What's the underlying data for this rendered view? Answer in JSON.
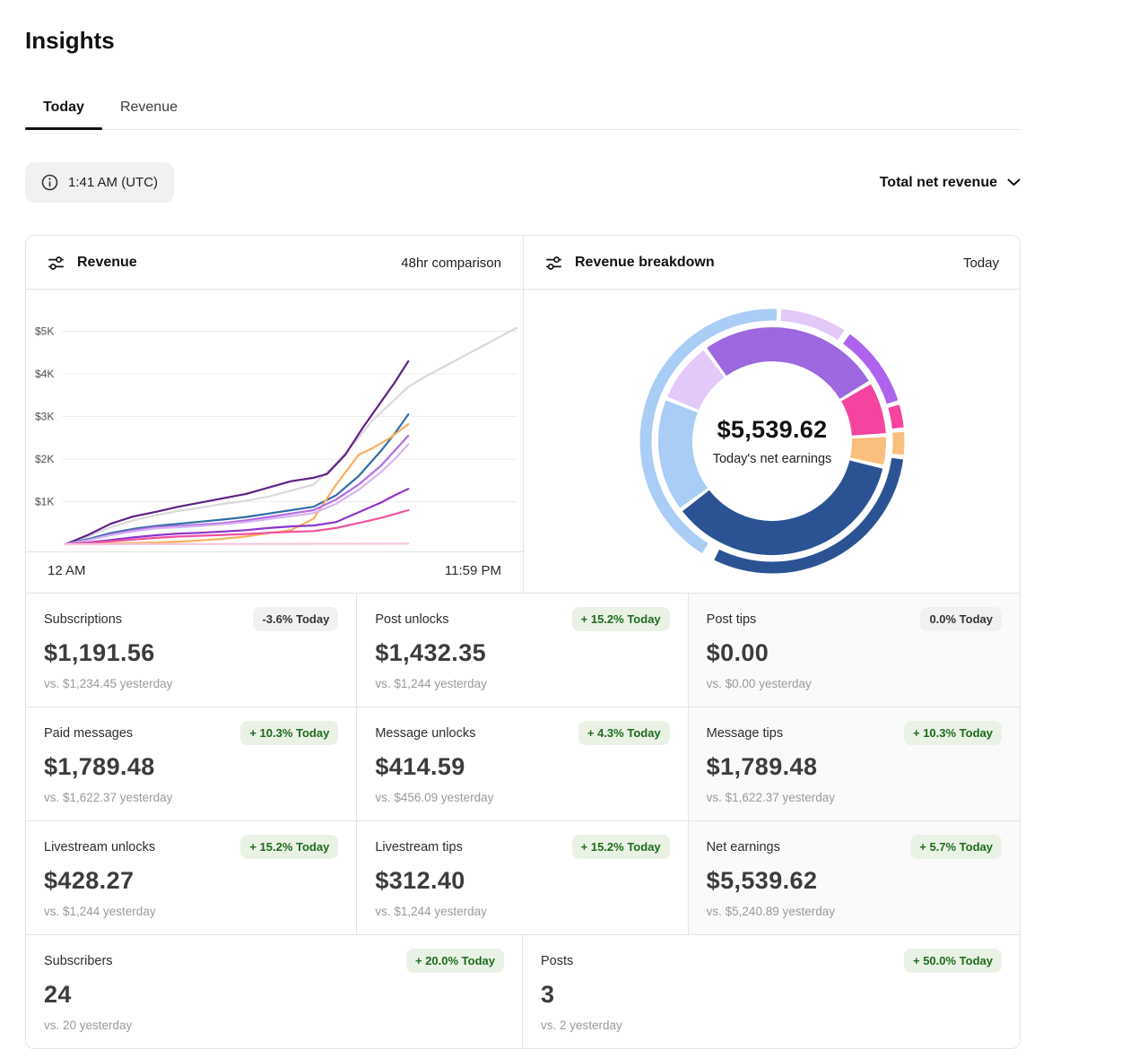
{
  "page": {
    "title": "Insights"
  },
  "tabs": [
    {
      "label": "Today",
      "active": true
    },
    {
      "label": "Revenue",
      "active": false
    }
  ],
  "toolbar": {
    "time_chip": "1:41 AM (UTC)",
    "metric_selector": "Total net revenue"
  },
  "revenue_card": {
    "title": "Revenue",
    "range_label": "48hr comparison",
    "x_start_label": "12 AM",
    "x_end_label": "11:59 PM"
  },
  "breakdown_card": {
    "title": "Revenue breakdown",
    "range_label": "Today",
    "center_value": "$5,539.62",
    "center_caption": "Today's net earnings"
  },
  "colors": {
    "positive_badge_text": "#1e6b1e",
    "positive_badge_bg": "#eaf2e5",
    "neutral_badge_text": "#333333",
    "neutral_badge_bg": "#f1f1f1",
    "grid_line": "#ededed",
    "card_border": "#e4e4e4",
    "muted_card_bg": "#fafafa"
  },
  "chart_data": [
    {
      "type": "line",
      "title": "Revenue",
      "subtitle": "48hr comparison",
      "xlabel": "",
      "ylabel": "",
      "x_range_labels": [
        "12 AM",
        "11:59 PM"
      ],
      "y_ticks": [
        "$1K",
        "$2K",
        "$3K",
        "$4K",
        "$5K"
      ],
      "y_tick_values": [
        1000,
        2000,
        3000,
        4000,
        5000
      ],
      "ylim": [
        0,
        5400
      ],
      "grid": true,
      "legend": false,
      "series": [
        {
          "name": "yesterday-total",
          "color": "#d9d9d9",
          "points": [
            [
              0,
              0
            ],
            [
              0.05,
              180
            ],
            [
              0.1,
              400
            ],
            [
              0.15,
              560
            ],
            [
              0.2,
              680
            ],
            [
              0.25,
              780
            ],
            [
              0.3,
              860
            ],
            [
              0.35,
              950
            ],
            [
              0.4,
              1020
            ],
            [
              0.45,
              1120
            ],
            [
              0.5,
              1260
            ],
            [
              0.55,
              1400
            ],
            [
              0.6,
              1900
            ],
            [
              0.65,
              2500
            ],
            [
              0.68,
              2900
            ],
            [
              0.72,
              3300
            ],
            [
              0.76,
              3700
            ],
            [
              0.8,
              3950
            ],
            [
              1,
              5080
            ]
          ]
        },
        {
          "name": "today-total",
          "color": "#5e2285",
          "points": [
            [
              0,
              0
            ],
            [
              0.05,
              220
            ],
            [
              0.1,
              480
            ],
            [
              0.15,
              650
            ],
            [
              0.2,
              760
            ],
            [
              0.25,
              880
            ],
            [
              0.3,
              980
            ],
            [
              0.35,
              1080
            ],
            [
              0.4,
              1180
            ],
            [
              0.45,
              1330
            ],
            [
              0.5,
              1480
            ],
            [
              0.55,
              1560
            ],
            [
              0.58,
              1650
            ],
            [
              0.62,
              2100
            ],
            [
              0.66,
              2750
            ],
            [
              0.7,
              3350
            ],
            [
              0.73,
              3800
            ],
            [
              0.76,
              4300
            ]
          ]
        },
        {
          "name": "blue-series",
          "color": "#2e6ea6",
          "points": [
            [
              0,
              0
            ],
            [
              0.05,
              120
            ],
            [
              0.1,
              260
            ],
            [
              0.15,
              360
            ],
            [
              0.2,
              430
            ],
            [
              0.25,
              480
            ],
            [
              0.3,
              530
            ],
            [
              0.35,
              580
            ],
            [
              0.4,
              640
            ],
            [
              0.45,
              720
            ],
            [
              0.5,
              800
            ],
            [
              0.55,
              880
            ],
            [
              0.6,
              1150
            ],
            [
              0.65,
              1600
            ],
            [
              0.7,
              2200
            ],
            [
              0.73,
              2600
            ],
            [
              0.76,
              3050
            ]
          ]
        },
        {
          "name": "orange-series",
          "color": "#f8b05c",
          "points": [
            [
              0,
              0
            ],
            [
              0.05,
              10
            ],
            [
              0.1,
              20
            ],
            [
              0.15,
              30
            ],
            [
              0.2,
              40
            ],
            [
              0.25,
              60
            ],
            [
              0.3,
              90
            ],
            [
              0.35,
              130
            ],
            [
              0.4,
              180
            ],
            [
              0.45,
              260
            ],
            [
              0.5,
              330
            ],
            [
              0.55,
              600
            ],
            [
              0.6,
              1400
            ],
            [
              0.65,
              2100
            ],
            [
              0.68,
              2250
            ],
            [
              0.72,
              2500
            ],
            [
              0.76,
              2820
            ]
          ]
        },
        {
          "name": "orchid-series",
          "color": "#b46ce6",
          "points": [
            [
              0,
              0
            ],
            [
              0.05,
              100
            ],
            [
              0.1,
              230
            ],
            [
              0.15,
              330
            ],
            [
              0.2,
              400
            ],
            [
              0.25,
              430
            ],
            [
              0.3,
              460
            ],
            [
              0.35,
              500
            ],
            [
              0.4,
              560
            ],
            [
              0.45,
              640
            ],
            [
              0.5,
              720
            ],
            [
              0.55,
              800
            ],
            [
              0.6,
              1050
            ],
            [
              0.65,
              1400
            ],
            [
              0.7,
              1850
            ],
            [
              0.73,
              2200
            ],
            [
              0.76,
              2550
            ]
          ]
        },
        {
          "name": "lavender-series",
          "color": "#d7b4f2",
          "points": [
            [
              0,
              0
            ],
            [
              0.05,
              90
            ],
            [
              0.1,
              210
            ],
            [
              0.15,
              300
            ],
            [
              0.2,
              370
            ],
            [
              0.25,
              400
            ],
            [
              0.3,
              430
            ],
            [
              0.35,
              470
            ],
            [
              0.4,
              520
            ],
            [
              0.45,
              590
            ],
            [
              0.5,
              660
            ],
            [
              0.55,
              730
            ],
            [
              0.6,
              950
            ],
            [
              0.65,
              1280
            ],
            [
              0.7,
              1700
            ],
            [
              0.73,
              2000
            ],
            [
              0.76,
              2350
            ]
          ]
        },
        {
          "name": "violet-series",
          "color": "#8d35cc",
          "points": [
            [
              0,
              0
            ],
            [
              0.05,
              40
            ],
            [
              0.1,
              100
            ],
            [
              0.15,
              160
            ],
            [
              0.2,
              210
            ],
            [
              0.25,
              250
            ],
            [
              0.3,
              270
            ],
            [
              0.35,
              300
            ],
            [
              0.4,
              330
            ],
            [
              0.45,
              380
            ],
            [
              0.5,
              420
            ],
            [
              0.55,
              440
            ],
            [
              0.6,
              520
            ],
            [
              0.65,
              750
            ],
            [
              0.7,
              980
            ],
            [
              0.73,
              1150
            ],
            [
              0.76,
              1300
            ]
          ]
        },
        {
          "name": "pink-series",
          "color": "#f2519f",
          "points": [
            [
              0,
              0
            ],
            [
              0.05,
              30
            ],
            [
              0.1,
              70
            ],
            [
              0.15,
              110
            ],
            [
              0.2,
              150
            ],
            [
              0.25,
              180
            ],
            [
              0.3,
              200
            ],
            [
              0.35,
              220
            ],
            [
              0.4,
              240
            ],
            [
              0.45,
              270
            ],
            [
              0.5,
              290
            ],
            [
              0.55,
              310
            ],
            [
              0.6,
              380
            ],
            [
              0.65,
              500
            ],
            [
              0.7,
              620
            ],
            [
              0.73,
              710
            ],
            [
              0.76,
              800
            ]
          ]
        },
        {
          "name": "pale-pink-series",
          "color": "#f6c3de",
          "points": [
            [
              0,
              0
            ],
            [
              0.76,
              15
            ]
          ]
        }
      ]
    },
    {
      "type": "donut",
      "title": "Revenue breakdown",
      "subtitle": "Today",
      "center_value": "$5,539.62",
      "center_caption": "Today's net earnings",
      "rings": [
        {
          "name": "outer",
          "radius": 141,
          "width": 13,
          "segments": [
            {
              "label": "lavender",
              "color": "#e2c9f8",
              "start": 4,
              "sweep": 29
            },
            {
              "label": "purple",
              "color": "#ae63ef",
              "start": 36,
              "sweep": 36
            },
            {
              "label": "pink",
              "color": "#f4449f",
              "start": 74,
              "sweep": 10
            },
            {
              "label": "orange",
              "color": "#f9c07d",
              "start": 86,
              "sweep": 10
            },
            {
              "label": "navy",
              "color": "#2b5394",
              "start": 98,
              "sweep": 108
            },
            {
              "label": "light-blue",
              "color": "#a9cdf5",
              "start": 212,
              "sweep": 150
            }
          ]
        },
        {
          "name": "inner",
          "radius": 108,
          "width": 38,
          "segments": [
            {
              "label": "purple",
              "color": "#9d68df",
              "start": 325,
              "sweep": 93
            },
            {
              "label": "pink",
              "color": "#f4449f",
              "start": 60,
              "sweep": 26
            },
            {
              "label": "orange",
              "color": "#f9c07d",
              "start": 88,
              "sweep": 14
            },
            {
              "label": "navy",
              "color": "#2b5394",
              "start": 104,
              "sweep": 128
            },
            {
              "label": "light-blue",
              "color": "#a9cdf5",
              "start": 234,
              "sweep": 57
            },
            {
              "label": "lavender",
              "color": "#e2c9f8",
              "start": 293,
              "sweep": 30
            }
          ]
        }
      ]
    }
  ],
  "stats": {
    "rows": [
      {
        "cells": [
          {
            "label": "Subscriptions",
            "badge": "-3.6% Today",
            "badge_type": "neutral",
            "value": "$1,191.56",
            "compare": "vs. $1,234.45 yesterday",
            "highlight": false
          },
          {
            "label": "Post unlocks",
            "badge": "+ 15.2% Today",
            "badge_type": "positive",
            "value": "$1,432.35",
            "compare": "vs. $1,244 yesterday",
            "highlight": false
          },
          {
            "label": "Post tips",
            "badge": "0.0% Today",
            "badge_type": "neutral",
            "value": "$0.00",
            "compare": "vs. $0.00 yesterday",
            "highlight": true
          }
        ]
      },
      {
        "cells": [
          {
            "label": "Paid messages",
            "badge": "+ 10.3% Today",
            "badge_type": "positive",
            "value": "$1,789.48",
            "compare": "vs. $1,622.37 yesterday",
            "highlight": false
          },
          {
            "label": "Message unlocks",
            "badge": "+ 4.3% Today",
            "badge_type": "positive",
            "value": "$414.59",
            "compare": "vs. $456.09 yesterday",
            "highlight": false
          },
          {
            "label": "Message tips",
            "badge": "+ 10.3% Today",
            "badge_type": "positive",
            "value": "$1,789.48",
            "compare": "vs. $1,622.37 yesterday",
            "highlight": true
          }
        ]
      },
      {
        "cells": [
          {
            "label": "Livestream unlocks",
            "badge": "+ 15.2% Today",
            "badge_type": "positive",
            "value": "$428.27",
            "compare": "vs. $1,244 yesterday",
            "highlight": false
          },
          {
            "label": "Livestream tips",
            "badge": "+ 15.2% Today",
            "badge_type": "positive",
            "value": "$312.40",
            "compare": "vs. $1,244 yesterday",
            "highlight": false
          },
          {
            "label": "Net earnings",
            "badge": "+ 5.7% Today",
            "badge_type": "positive",
            "value": "$5,539.62",
            "compare": "vs. $5,240.89 yesterday",
            "highlight": true
          }
        ]
      },
      {
        "cells": [
          {
            "label": "Subscribers",
            "badge": "+ 20.0% Today",
            "badge_type": "positive",
            "value": "24",
            "compare": "vs. 20 yesterday",
            "highlight": false
          },
          {
            "label": "Posts",
            "badge": "+ 50.0% Today",
            "badge_type": "positive",
            "value": "3",
            "compare": "vs. 2 yesterday",
            "highlight": false
          }
        ]
      }
    ]
  }
}
